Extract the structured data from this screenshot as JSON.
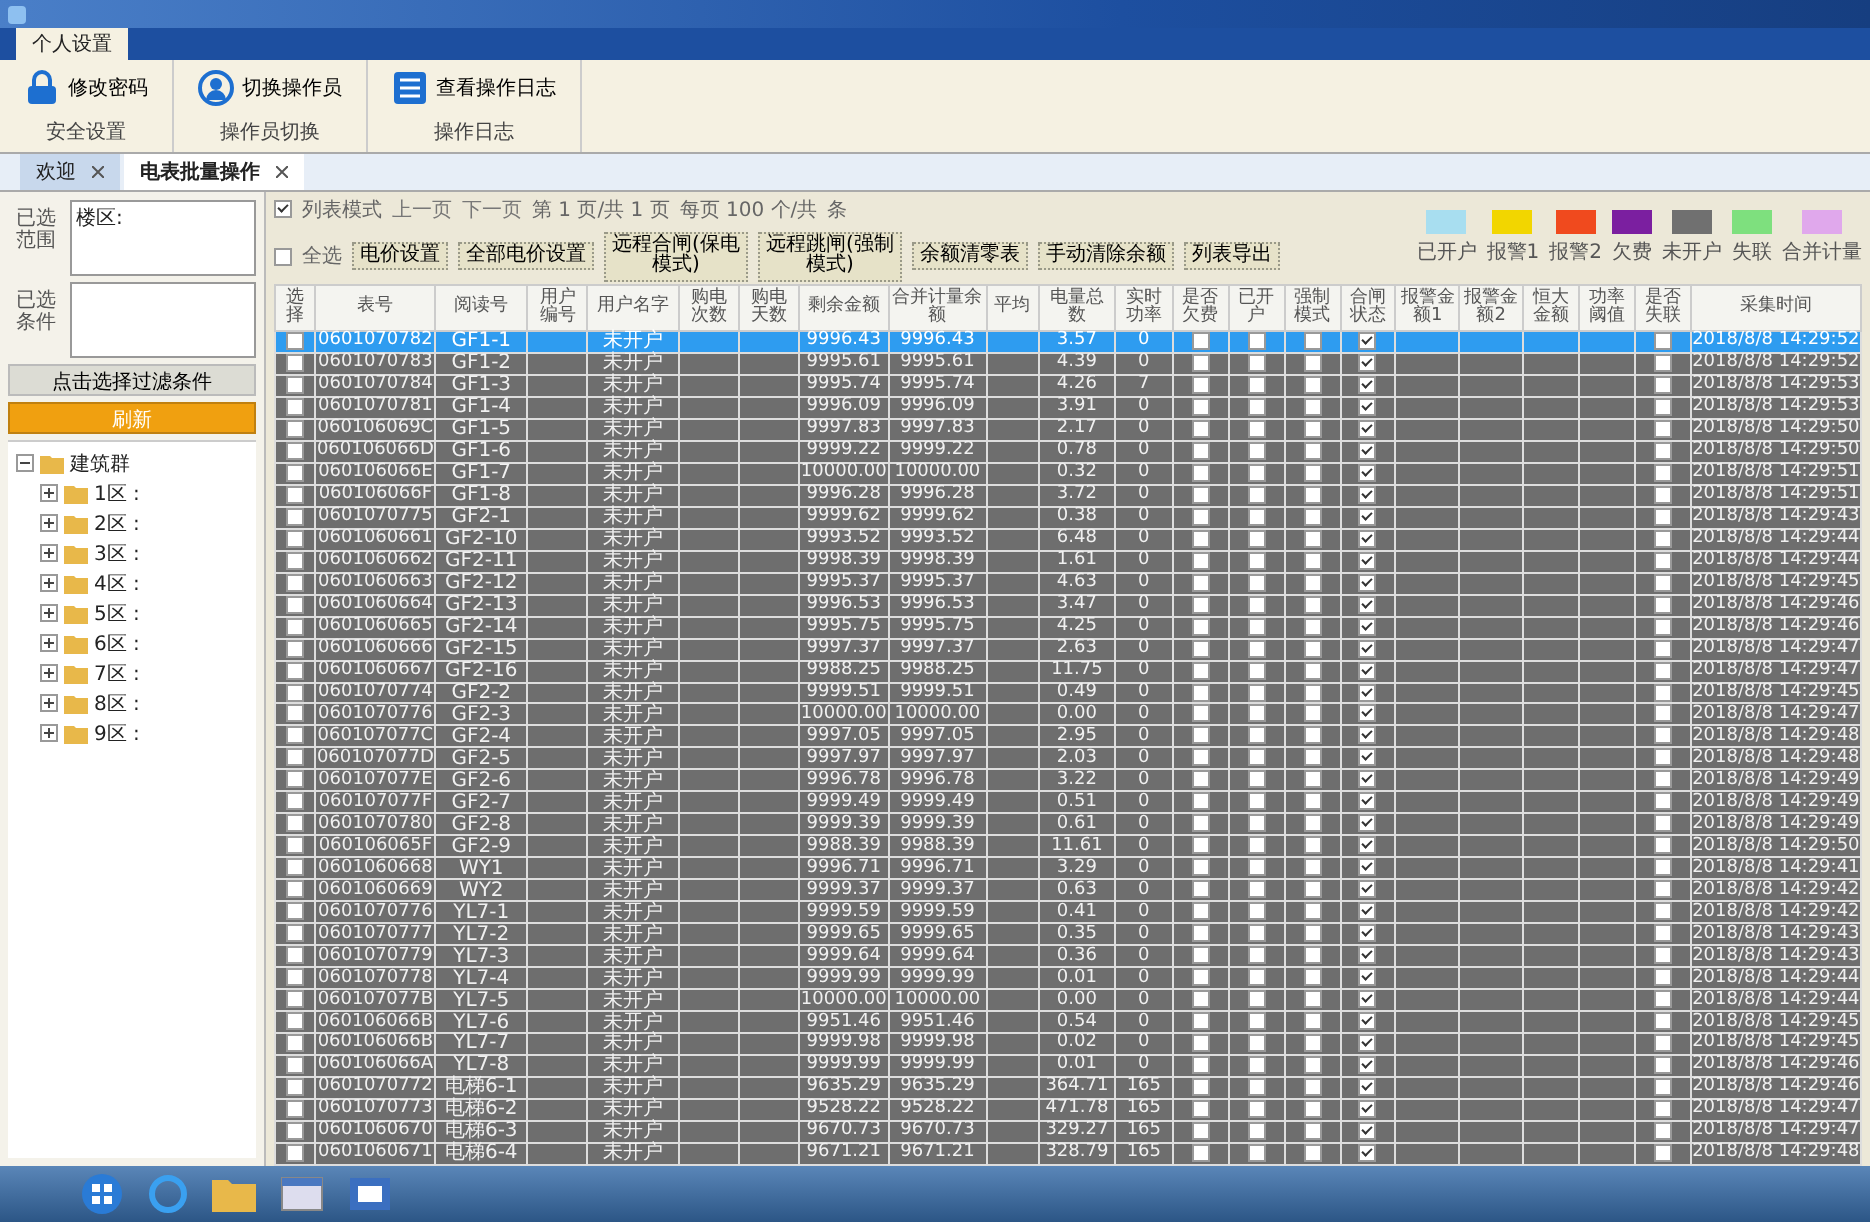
{
  "ribbon_tabs": [
    {
      "label": "个人设置",
      "selected": true
    }
  ],
  "ribbon_groups": [
    {
      "label": "安全设置",
      "button": "修改密码",
      "kind": "lock"
    },
    {
      "label": "操作员切换",
      "button": "切换操作员",
      "kind": "user"
    },
    {
      "label": "操作日志",
      "button": "查看操作日志",
      "kind": "list"
    }
  ],
  "doc_tabs": [
    {
      "label": "欢迎",
      "selected": false
    },
    {
      "label": "电表批量操作",
      "selected": true
    }
  ],
  "sidebar": {
    "range_label": "已选范围",
    "range_value": "楼区:",
    "condition_label": "已选条件",
    "filter_button": "点击选择过滤条件",
    "refresh_button": "刷新",
    "tree": [
      {
        "label": "建筑群",
        "expanded": true,
        "children": [
          {
            "label": "1区 :",
            "expanded": false
          },
          {
            "label": "2区 :",
            "expanded": false
          },
          {
            "label": "3区 :",
            "expanded": false
          },
          {
            "label": "4区 :",
            "expanded": false
          },
          {
            "label": "5区 :",
            "expanded": false
          },
          {
            "label": "6区 :",
            "expanded": false
          },
          {
            "label": "7区 :",
            "expanded": false
          },
          {
            "label": "8区 :",
            "expanded": false
          },
          {
            "label": "9区 :",
            "expanded": false
          }
        ]
      }
    ]
  },
  "toolbar": {
    "list_mode": {
      "label": "列表模式",
      "checked": true
    },
    "prev": "上一页",
    "next": "下一页",
    "page_info": "第 1 页/共 1 页",
    "per_page": "每页 100 个/共",
    "count_suffix": "条",
    "select_all": {
      "label": "全选",
      "checked": false
    },
    "buttons": [
      "电价设置",
      "全部电价设置",
      "远程合闸(保电模式)",
      "远程跳闸(强制模式)",
      "余额清零表",
      "手动清除余额",
      "列表导出"
    ]
  },
  "legend": [
    {
      "label": "已开户",
      "color": "#a8def0"
    },
    {
      "label": "报警1",
      "color": "#f2d600"
    },
    {
      "label": "报警2",
      "color": "#f04a1e"
    },
    {
      "label": "欠费",
      "color": "#7b1fa0"
    },
    {
      "label": "未开户",
      "color": "#707070"
    },
    {
      "label": "失联",
      "color": "#7ee07e"
    },
    {
      "label": "合并计量",
      "color": "#e0a8ec"
    }
  ],
  "table": {
    "columns": [
      "选择",
      "表号",
      "阅读号",
      "用户编号",
      "用户名字",
      "购电次数",
      "购电天数",
      "剩余金额",
      "合并计量余额",
      "平均",
      "电量总数",
      "实时功率",
      "是否欠费",
      "已开户",
      "强制模式",
      "合闸状态",
      "报警金额1",
      "报警金额2",
      "恒大金额",
      "功率阈值",
      "是否失联",
      "采集时间"
    ],
    "rows": [
      {
        "selected": true,
        "checked": false,
        "meter": "0601070782",
        "reading": "GF1-1",
        "user": "未开户",
        "balance": "9996.43",
        "merged": "9996.43",
        "energy": "3.57",
        "power": "0",
        "arrears": false,
        "opened": false,
        "forced": false,
        "switch_on": true,
        "offline": false,
        "time": "2018/8/8 14:29:52"
      },
      {
        "selected": false,
        "checked": false,
        "meter": "0601070783",
        "reading": "GF1-2",
        "user": "未开户",
        "balance": "9995.61",
        "merged": "9995.61",
        "energy": "4.39",
        "power": "0",
        "arrears": false,
        "opened": false,
        "forced": false,
        "switch_on": true,
        "offline": false,
        "time": "2018/8/8 14:29:52"
      },
      {
        "selected": false,
        "checked": false,
        "meter": "0601070784",
        "reading": "GF1-3",
        "user": "未开户",
        "balance": "9995.74",
        "merged": "9995.74",
        "energy": "4.26",
        "power": "7",
        "arrears": false,
        "opened": false,
        "forced": false,
        "switch_on": true,
        "offline": false,
        "time": "2018/8/8 14:29:53"
      },
      {
        "selected": false,
        "checked": false,
        "meter": "0601070781",
        "reading": "GF1-4",
        "user": "未开户",
        "balance": "9996.09",
        "merged": "9996.09",
        "energy": "3.91",
        "power": "0",
        "arrears": false,
        "opened": false,
        "forced": false,
        "switch_on": true,
        "offline": false,
        "time": "2018/8/8 14:29:53"
      },
      {
        "selected": false,
        "checked": false,
        "meter": "060106069C",
        "reading": "GF1-5",
        "user": "未开户",
        "balance": "9997.83",
        "merged": "9997.83",
        "energy": "2.17",
        "power": "0",
        "arrears": false,
        "opened": false,
        "forced": false,
        "switch_on": true,
        "offline": false,
        "time": "2018/8/8 14:29:50"
      },
      {
        "selected": false,
        "checked": false,
        "meter": "060106066D",
        "reading": "GF1-6",
        "user": "未开户",
        "balance": "9999.22",
        "merged": "9999.22",
        "energy": "0.78",
        "power": "0",
        "arrears": false,
        "opened": false,
        "forced": false,
        "switch_on": true,
        "offline": false,
        "time": "2018/8/8 14:29:50"
      },
      {
        "selected": false,
        "checked": false,
        "meter": "060106066E",
        "reading": "GF1-7",
        "user": "未开户",
        "balance": "10000.00",
        "merged": "10000.00",
        "energy": "0.32",
        "power": "0",
        "arrears": false,
        "opened": false,
        "forced": false,
        "switch_on": true,
        "offline": false,
        "time": "2018/8/8 14:29:51"
      },
      {
        "selected": false,
        "checked": false,
        "meter": "060106066F",
        "reading": "GF1-8",
        "user": "未开户",
        "balance": "9996.28",
        "merged": "9996.28",
        "energy": "3.72",
        "power": "0",
        "arrears": false,
        "opened": false,
        "forced": false,
        "switch_on": true,
        "offline": false,
        "time": "2018/8/8 14:29:51"
      },
      {
        "selected": false,
        "checked": false,
        "meter": "0601070775",
        "reading": "GF2-1",
        "user": "未开户",
        "balance": "9999.62",
        "merged": "9999.62",
        "energy": "0.38",
        "power": "0",
        "arrears": false,
        "opened": false,
        "forced": false,
        "switch_on": true,
        "offline": false,
        "time": "2018/8/8 14:29:43"
      },
      {
        "selected": false,
        "checked": false,
        "meter": "0601060661",
        "reading": "GF2-10",
        "user": "未开户",
        "balance": "9993.52",
        "merged": "9993.52",
        "energy": "6.48",
        "power": "0",
        "arrears": false,
        "opened": false,
        "forced": false,
        "switch_on": true,
        "offline": false,
        "time": "2018/8/8 14:29:44"
      },
      {
        "selected": false,
        "checked": false,
        "meter": "0601060662",
        "reading": "GF2-11",
        "user": "未开户",
        "balance": "9998.39",
        "merged": "9998.39",
        "energy": "1.61",
        "power": "0",
        "arrears": false,
        "opened": false,
        "forced": false,
        "switch_on": true,
        "offline": false,
        "time": "2018/8/8 14:29:44"
      },
      {
        "selected": false,
        "checked": false,
        "meter": "0601060663",
        "reading": "GF2-12",
        "user": "未开户",
        "balance": "9995.37",
        "merged": "9995.37",
        "energy": "4.63",
        "power": "0",
        "arrears": false,
        "opened": false,
        "forced": false,
        "switch_on": true,
        "offline": false,
        "time": "2018/8/8 14:29:45"
      },
      {
        "selected": false,
        "checked": false,
        "meter": "0601060664",
        "reading": "GF2-13",
        "user": "未开户",
        "balance": "9996.53",
        "merged": "9996.53",
        "energy": "3.47",
        "power": "0",
        "arrears": false,
        "opened": false,
        "forced": false,
        "switch_on": true,
        "offline": false,
        "time": "2018/8/8 14:29:46"
      },
      {
        "selected": false,
        "checked": false,
        "meter": "0601060665",
        "reading": "GF2-14",
        "user": "未开户",
        "balance": "9995.75",
        "merged": "9995.75",
        "energy": "4.25",
        "power": "0",
        "arrears": false,
        "opened": false,
        "forced": false,
        "switch_on": true,
        "offline": false,
        "time": "2018/8/8 14:29:46"
      },
      {
        "selected": false,
        "checked": false,
        "meter": "0601060666",
        "reading": "GF2-15",
        "user": "未开户",
        "balance": "9997.37",
        "merged": "9997.37",
        "energy": "2.63",
        "power": "0",
        "arrears": false,
        "opened": false,
        "forced": false,
        "switch_on": true,
        "offline": false,
        "time": "2018/8/8 14:29:47"
      },
      {
        "selected": false,
        "checked": false,
        "meter": "0601060667",
        "reading": "GF2-16",
        "user": "未开户",
        "balance": "9988.25",
        "merged": "9988.25",
        "energy": "11.75",
        "power": "0",
        "arrears": false,
        "opened": false,
        "forced": false,
        "switch_on": true,
        "offline": false,
        "time": "2018/8/8 14:29:47"
      },
      {
        "selected": false,
        "checked": false,
        "meter": "0601070774",
        "reading": "GF2-2",
        "user": "未开户",
        "balance": "9999.51",
        "merged": "9999.51",
        "energy": "0.49",
        "power": "0",
        "arrears": false,
        "opened": false,
        "forced": false,
        "switch_on": true,
        "offline": false,
        "time": "2018/8/8 14:29:45"
      },
      {
        "selected": false,
        "checked": false,
        "meter": "0601070776",
        "reading": "GF2-3",
        "user": "未开户",
        "balance": "10000.00",
        "merged": "10000.00",
        "energy": "0.00",
        "power": "0",
        "arrears": false,
        "opened": false,
        "forced": false,
        "switch_on": true,
        "offline": false,
        "time": "2018/8/8 14:29:47"
      },
      {
        "selected": false,
        "checked": false,
        "meter": "060107077C",
        "reading": "GF2-4",
        "user": "未开户",
        "balance": "9997.05",
        "merged": "9997.05",
        "energy": "2.95",
        "power": "0",
        "arrears": false,
        "opened": false,
        "forced": false,
        "switch_on": true,
        "offline": false,
        "time": "2018/8/8 14:29:48"
      },
      {
        "selected": false,
        "checked": false,
        "meter": "060107077D",
        "reading": "GF2-5",
        "user": "未开户",
        "balance": "9997.97",
        "merged": "9997.97",
        "energy": "2.03",
        "power": "0",
        "arrears": false,
        "opened": false,
        "forced": false,
        "switch_on": true,
        "offline": false,
        "time": "2018/8/8 14:29:48"
      },
      {
        "selected": false,
        "checked": false,
        "meter": "060107077E",
        "reading": "GF2-6",
        "user": "未开户",
        "balance": "9996.78",
        "merged": "9996.78",
        "energy": "3.22",
        "power": "0",
        "arrears": false,
        "opened": false,
        "forced": false,
        "switch_on": true,
        "offline": false,
        "time": "2018/8/8 14:29:49"
      },
      {
        "selected": false,
        "checked": false,
        "meter": "060107077F",
        "reading": "GF2-7",
        "user": "未开户",
        "balance": "9999.49",
        "merged": "9999.49",
        "energy": "0.51",
        "power": "0",
        "arrears": false,
        "opened": false,
        "forced": false,
        "switch_on": true,
        "offline": false,
        "time": "2018/8/8 14:29:49"
      },
      {
        "selected": false,
        "checked": false,
        "meter": "0601070780",
        "reading": "GF2-8",
        "user": "未开户",
        "balance": "9999.39",
        "merged": "9999.39",
        "energy": "0.61",
        "power": "0",
        "arrears": false,
        "opened": false,
        "forced": false,
        "switch_on": true,
        "offline": false,
        "time": "2018/8/8 14:29:49"
      },
      {
        "selected": false,
        "checked": false,
        "meter": "060106065F",
        "reading": "GF2-9",
        "user": "未开户",
        "balance": "9988.39",
        "merged": "9988.39",
        "energy": "11.61",
        "power": "0",
        "arrears": false,
        "opened": false,
        "forced": false,
        "switch_on": true,
        "offline": false,
        "time": "2018/8/8 14:29:50"
      },
      {
        "selected": false,
        "checked": false,
        "meter": "0601060668",
        "reading": "WY1",
        "user": "未开户",
        "balance": "9996.71",
        "merged": "9996.71",
        "energy": "3.29",
        "power": "0",
        "arrears": false,
        "opened": false,
        "forced": false,
        "switch_on": true,
        "offline": false,
        "time": "2018/8/8 14:29:41"
      },
      {
        "selected": false,
        "checked": false,
        "meter": "0601060669",
        "reading": "WY2",
        "user": "未开户",
        "balance": "9999.37",
        "merged": "9999.37",
        "energy": "0.63",
        "power": "0",
        "arrears": false,
        "opened": false,
        "forced": false,
        "switch_on": true,
        "offline": false,
        "time": "2018/8/8 14:29:42"
      },
      {
        "selected": false,
        "checked": false,
        "meter": "0601070776",
        "reading": "YL7-1",
        "user": "未开户",
        "balance": "9999.59",
        "merged": "9999.59",
        "energy": "0.41",
        "power": "0",
        "arrears": false,
        "opened": false,
        "forced": false,
        "switch_on": true,
        "offline": false,
        "time": "2018/8/8 14:29:42"
      },
      {
        "selected": false,
        "checked": false,
        "meter": "0601070777",
        "reading": "YL7-2",
        "user": "未开户",
        "balance": "9999.65",
        "merged": "9999.65",
        "energy": "0.35",
        "power": "0",
        "arrears": false,
        "opened": false,
        "forced": false,
        "switch_on": true,
        "offline": false,
        "time": "2018/8/8 14:29:43"
      },
      {
        "selected": false,
        "checked": false,
        "meter": "0601070779",
        "reading": "YL7-3",
        "user": "未开户",
        "balance": "9999.64",
        "merged": "9999.64",
        "energy": "0.36",
        "power": "0",
        "arrears": false,
        "opened": false,
        "forced": false,
        "switch_on": true,
        "offline": false,
        "time": "2018/8/8 14:29:43"
      },
      {
        "selected": false,
        "checked": false,
        "meter": "0601070778",
        "reading": "YL7-4",
        "user": "未开户",
        "balance": "9999.99",
        "merged": "9999.99",
        "energy": "0.01",
        "power": "0",
        "arrears": false,
        "opened": false,
        "forced": false,
        "switch_on": true,
        "offline": false,
        "time": "2018/8/8 14:29:44"
      },
      {
        "selected": false,
        "checked": false,
        "meter": "060107077B",
        "reading": "YL7-5",
        "user": "未开户",
        "balance": "10000.00",
        "merged": "10000.00",
        "energy": "0.00",
        "power": "0",
        "arrears": false,
        "opened": false,
        "forced": false,
        "switch_on": true,
        "offline": false,
        "time": "2018/8/8 14:29:44"
      },
      {
        "selected": false,
        "checked": false,
        "meter": "060106066B",
        "reading": "YL7-6",
        "user": "未开户",
        "balance": "9951.46",
        "merged": "9951.46",
        "energy": "0.54",
        "power": "0",
        "arrears": false,
        "opened": false,
        "forced": false,
        "switch_on": true,
        "offline": false,
        "time": "2018/8/8 14:29:45"
      },
      {
        "selected": false,
        "checked": false,
        "meter": "060106066B",
        "reading": "YL7-7",
        "user": "未开户",
        "balance": "9999.98",
        "merged": "9999.98",
        "energy": "0.02",
        "power": "0",
        "arrears": false,
        "opened": false,
        "forced": false,
        "switch_on": true,
        "offline": false,
        "time": "2018/8/8 14:29:45"
      },
      {
        "selected": false,
        "checked": false,
        "meter": "060106066A",
        "reading": "YL7-8",
        "user": "未开户",
        "balance": "9999.99",
        "merged": "9999.99",
        "energy": "0.01",
        "power": "0",
        "arrears": false,
        "opened": false,
        "forced": false,
        "switch_on": true,
        "offline": false,
        "time": "2018/8/8 14:29:46"
      },
      {
        "selected": false,
        "checked": false,
        "meter": "0601070772",
        "reading": "电梯6-1",
        "user": "未开户",
        "balance": "9635.29",
        "merged": "9635.29",
        "energy": "364.71",
        "power": "165",
        "arrears": false,
        "opened": false,
        "forced": false,
        "switch_on": true,
        "offline": false,
        "time": "2018/8/8 14:29:46"
      },
      {
        "selected": false,
        "checked": false,
        "meter": "0601070773",
        "reading": "电梯6-2",
        "user": "未开户",
        "balance": "9528.22",
        "merged": "9528.22",
        "energy": "471.78",
        "power": "165",
        "arrears": false,
        "opened": false,
        "forced": false,
        "switch_on": true,
        "offline": false,
        "time": "2018/8/8 14:29:47"
      },
      {
        "selected": false,
        "checked": false,
        "meter": "0601060670",
        "reading": "电梯6-3",
        "user": "未开户",
        "balance": "9670.73",
        "merged": "9670.73",
        "energy": "329.27",
        "power": "165",
        "arrears": false,
        "opened": false,
        "forced": false,
        "switch_on": true,
        "offline": false,
        "time": "2018/8/8 14:29:47"
      },
      {
        "selected": false,
        "checked": false,
        "meter": "0601060671",
        "reading": "电梯6-4",
        "user": "未开户",
        "balance": "9671.21",
        "merged": "9671.21",
        "energy": "328.79",
        "power": "165",
        "arrears": false,
        "opened": false,
        "forced": false,
        "switch_on": true,
        "offline": false,
        "time": "2018/8/8 14:29:48"
      }
    ]
  }
}
